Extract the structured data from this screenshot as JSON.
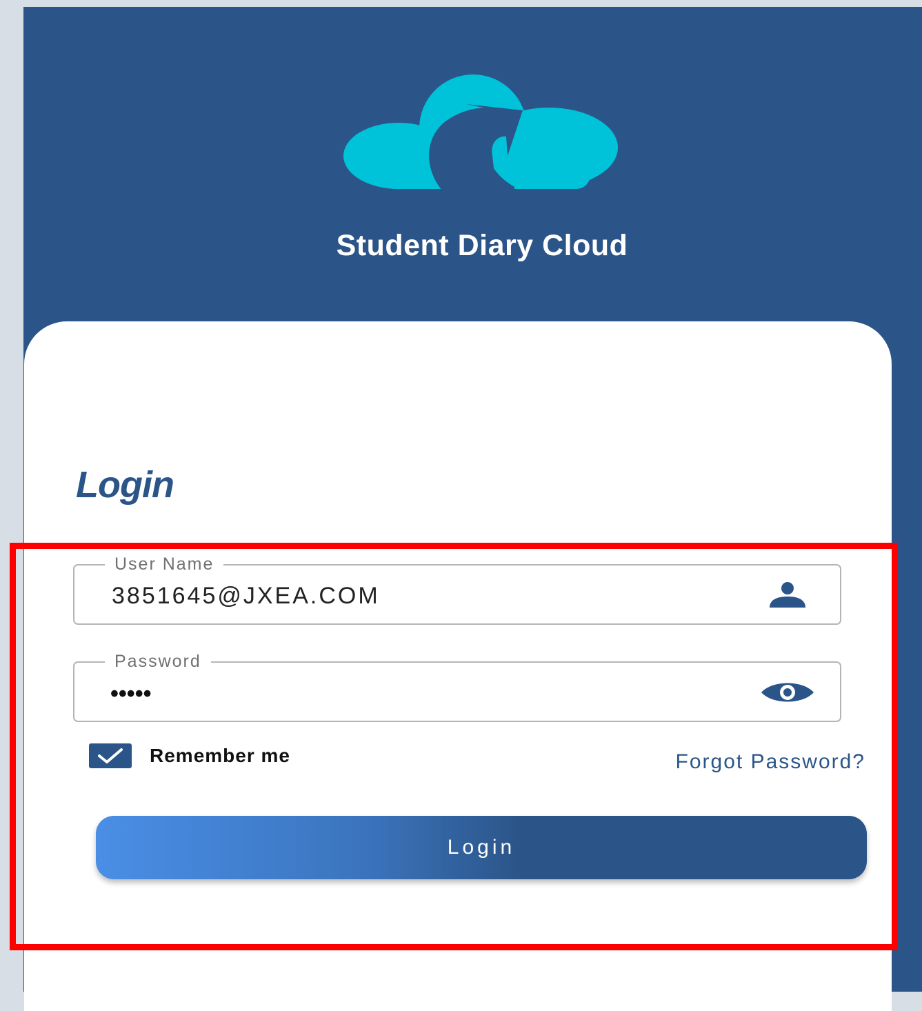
{
  "app": {
    "brand_title": "Student Diary Cloud",
    "logo_icon": "cloud-arrow-logo",
    "accent_color": "#2b5588",
    "logo_color": "#00c2d8"
  },
  "login": {
    "heading": "Login",
    "username": {
      "label": "User Name",
      "value": "3851645@JXEA.COM",
      "icon": "user-icon"
    },
    "password": {
      "label": "Password",
      "masked_value": "•••••",
      "icon": "eye-icon"
    },
    "remember_me": {
      "label": "Remember me",
      "checked": true
    },
    "forgot_password_label": "Forgot Password?",
    "submit_label": "Login"
  },
  "annotation": {
    "highlight_color": "#ff0000"
  }
}
